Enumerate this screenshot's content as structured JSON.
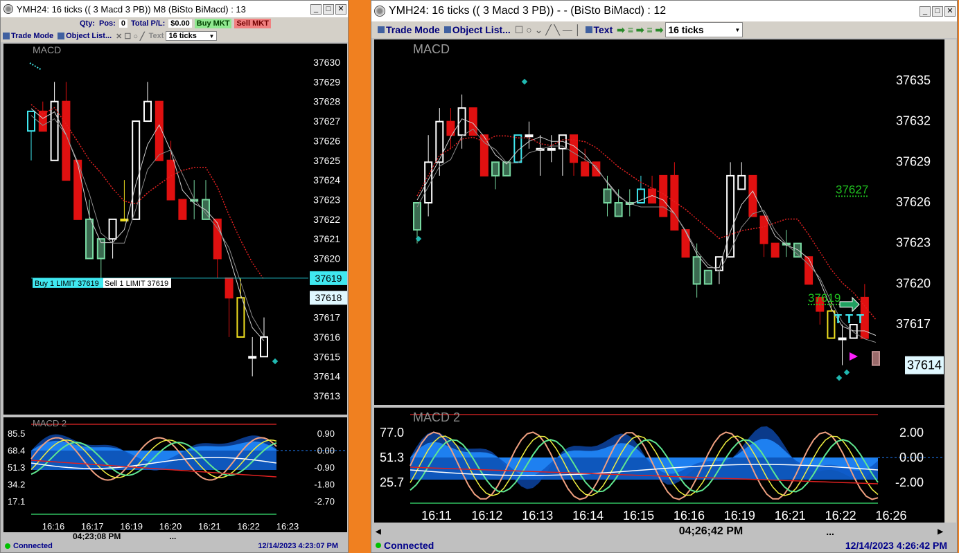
{
  "left": {
    "title": "YMH24: 16 ticks ((  3 Macd  3 PB)) M8 (BiSto BiMacd) : 13",
    "toolbar": {
      "qty_label": "Qty:",
      "pos_label": "Pos:",
      "pos_value": "0",
      "pl_label": "Total P/L:",
      "pl_value": "$0.00",
      "buy_label": "Buy MKT",
      "sell_label": "Sell MKT",
      "trade_mode": "Trade Mode",
      "object_list": "Object List...",
      "text": "Text",
      "ticks": "16 ticks"
    },
    "price_chart": {
      "indicator": "MACD",
      "prices": [
        "37630",
        "37629",
        "37628",
        "37627",
        "37626",
        "37625",
        "37624",
        "37623",
        "37622",
        "37621",
        "37620",
        "37619",
        "37618",
        "37617",
        "37616",
        "37615",
        "37614",
        "37613"
      ],
      "order_buy": "Buy 1 LIMIT 37619",
      "order_sell": "Sell 1 LIMIT 37619",
      "current_price": "37619",
      "price_tag2": "37618",
      "candles": [
        {
          "o": 37626.5,
          "c": 37627.5,
          "h": 37627.5,
          "l": 37625,
          "col": "cyan"
        },
        {
          "o": 37627.5,
          "c": 37626.5,
          "h": 37628,
          "l": 37626.5,
          "col": "red"
        },
        {
          "o": 37625,
          "c": 37628,
          "h": 37629,
          "l": 37625,
          "col": "white"
        },
        {
          "o": 37628,
          "c": 37624,
          "h": 37629,
          "l": 37624,
          "col": "red"
        },
        {
          "o": 37625,
          "c": 37622,
          "h": 37625,
          "l": 37622,
          "col": "red"
        },
        {
          "o": 37622,
          "c": 37620,
          "h": 37623,
          "l": 37620,
          "col": "green"
        },
        {
          "o": 37621,
          "c": 37620,
          "h": 37621,
          "l": 37619,
          "col": "green"
        },
        {
          "o": 37621,
          "c": 37622,
          "h": 37622,
          "l": 37620,
          "col": "white"
        },
        {
          "o": 37622,
          "c": 37622,
          "h": 37624,
          "l": 37622,
          "col": "yellow"
        },
        {
          "o": 37622,
          "c": 37627,
          "h": 37627,
          "l": 37622,
          "col": "white"
        },
        {
          "o": 37627,
          "c": 37628,
          "h": 37629,
          "l": 37627,
          "col": "white"
        },
        {
          "o": 37628,
          "c": 37625,
          "h": 37628,
          "l": 37625,
          "col": "red"
        },
        {
          "o": 37625,
          "c": 37623,
          "h": 37626,
          "l": 37623,
          "col": "red"
        },
        {
          "o": 37623,
          "c": 37622,
          "h": 37623,
          "l": 37622,
          "col": "red"
        },
        {
          "o": 37623,
          "c": 37623,
          "h": 37624,
          "l": 37622,
          "col": "green"
        },
        {
          "o": 37623,
          "c": 37622,
          "h": 37624,
          "l": 37622,
          "col": "green"
        },
        {
          "o": 37622,
          "c": 37620,
          "h": 37622,
          "l": 37619,
          "col": "red"
        },
        {
          "o": 37619,
          "c": 37618,
          "h": 37619,
          "l": 37616,
          "col": "red"
        },
        {
          "o": 37618,
          "c": 37616,
          "h": 37619,
          "l": 37616,
          "col": "yellow"
        },
        {
          "o": 37615,
          "c": 37615,
          "h": 37616,
          "l": 37614,
          "col": "white"
        },
        {
          "o": 37615,
          "c": 37616,
          "h": 37617,
          "l": 37615,
          "col": "white"
        }
      ]
    },
    "macd_panel": {
      "label": "MACD 2",
      "left_scale": [
        "85.5",
        "68.4",
        "51.3",
        "34.2",
        "17.1"
      ],
      "right_scale": [
        "0.90",
        "0.00",
        "-0.90",
        "-1.80",
        "-2.70"
      ],
      "times": [
        "16:16",
        "16:17",
        "16:19",
        "16:20",
        "16:21",
        "16:22",
        "16:23"
      ]
    },
    "scroll_time": "04;23;08  PM",
    "status": "Connected",
    "datetime": "12/14/2023 4:23:07 PM"
  },
  "right": {
    "title": "YMH24: 16 ticks ((  3 Macd  3 PB)) - -  (BiSto BiMacd) : 12",
    "toolbar": {
      "trade_mode": "Trade Mode",
      "object_list": "Object List...",
      "text": "Text",
      "ticks": "16 ticks"
    },
    "price_chart": {
      "indicator": "MACD",
      "prices": [
        "37635",
        "37632",
        "37629",
        "37626",
        "37623",
        "37620",
        "37617"
      ],
      "current_price": "37614",
      "label_upper": "37627",
      "label_lower": "37619",
      "candles": [
        {
          "o": 37624,
          "c": 37626,
          "h": 37626,
          "l": 37623,
          "col": "green"
        },
        {
          "o": 37626,
          "c": 37629,
          "h": 37631,
          "l": 37625,
          "col": "white"
        },
        {
          "o": 37629,
          "c": 37632,
          "h": 37633,
          "l": 37628,
          "col": "white"
        },
        {
          "o": 37632,
          "c": 37631,
          "h": 37633,
          "l": 37630,
          "col": "red"
        },
        {
          "o": 37631,
          "c": 37633,
          "h": 37634,
          "l": 37630,
          "col": "white"
        },
        {
          "o": 37633,
          "c": 37631,
          "h": 37633,
          "l": 37631,
          "col": "red"
        },
        {
          "o": 37631,
          "c": 37628,
          "h": 37631,
          "l": 37628,
          "col": "red"
        },
        {
          "o": 37628,
          "c": 37629,
          "h": 37629,
          "l": 37627,
          "col": "green"
        },
        {
          "o": 37628,
          "c": 37629,
          "h": 37629,
          "l": 37628,
          "col": "green"
        },
        {
          "o": 37629,
          "c": 37631,
          "h": 37631,
          "l": 37629,
          "col": "cyan"
        },
        {
          "o": 37631,
          "c": 37631,
          "h": 37632,
          "l": 37630,
          "col": "white"
        },
        {
          "o": 37630,
          "c": 37630,
          "h": 37631,
          "l": 37628,
          "col": "white"
        },
        {
          "o": 37630,
          "c": 37630,
          "h": 37631,
          "l": 37629,
          "col": "white"
        },
        {
          "o": 37630,
          "c": 37631,
          "h": 37631,
          "l": 37628,
          "col": "white"
        },
        {
          "o": 37631,
          "c": 37629,
          "h": 37631,
          "l": 37628,
          "col": "red"
        },
        {
          "o": 37629,
          "c": 37628,
          "h": 37630,
          "l": 37628,
          "col": "red"
        },
        {
          "o": 37629,
          "c": 37628,
          "h": 37629,
          "l": 37628,
          "col": "red"
        },
        {
          "o": 37627,
          "c": 37626,
          "h": 37628,
          "l": 37625,
          "col": "green"
        },
        {
          "o": 37626,
          "c": 37625,
          "h": 37627,
          "l": 37625,
          "col": "green"
        },
        {
          "o": 37626,
          "c": 37626,
          "h": 37627,
          "l": 37625,
          "col": "green"
        },
        {
          "o": 37626,
          "c": 37627,
          "h": 37628,
          "l": 37626,
          "col": "cyan"
        },
        {
          "o": 37627,
          "c": 37626,
          "h": 37628,
          "l": 37626,
          "col": "red"
        },
        {
          "o": 37628,
          "c": 37625,
          "h": 37628,
          "l": 37625,
          "col": "red"
        },
        {
          "o": 37628,
          "c": 37624,
          "h": 37629,
          "l": 37624,
          "col": "red"
        },
        {
          "o": 37624,
          "c": 37622,
          "h": 37624,
          "l": 37622,
          "col": "red"
        },
        {
          "o": 37622,
          "c": 37620,
          "h": 37623,
          "l": 37619,
          "col": "green"
        },
        {
          "o": 37620,
          "c": 37621,
          "h": 37621,
          "l": 37620,
          "col": "green"
        },
        {
          "o": 37621,
          "c": 37622,
          "h": 37622,
          "l": 37620,
          "col": "white"
        },
        {
          "o": 37622,
          "c": 37628,
          "h": 37629,
          "l": 37622,
          "col": "white"
        },
        {
          "o": 37628,
          "c": 37627,
          "h": 37629,
          "l": 37627,
          "col": "white"
        },
        {
          "o": 37628,
          "c": 37625,
          "h": 37628,
          "l": 37625,
          "col": "red"
        },
        {
          "o": 37625,
          "c": 37623,
          "h": 37625,
          "l": 37622,
          "col": "red"
        },
        {
          "o": 37623,
          "c": 37622,
          "h": 37623,
          "l": 37622,
          "col": "red"
        },
        {
          "o": 37623,
          "c": 37623,
          "h": 37624,
          "l": 37622,
          "col": "green"
        },
        {
          "o": 37623,
          "c": 37622,
          "h": 37623,
          "l": 37622,
          "col": "green"
        },
        {
          "o": 37622,
          "c": 37620,
          "h": 37622,
          "l": 37620,
          "col": "red"
        },
        {
          "o": 37619,
          "c": 37618,
          "h": 37619,
          "l": 37617,
          "col": "red"
        },
        {
          "o": 37618,
          "c": 37616,
          "h": 37619,
          "l": 37616,
          "col": "yellow"
        },
        {
          "o": 37616,
          "c": 37616,
          "h": 37617,
          "l": 37614,
          "col": "white"
        },
        {
          "o": 37616,
          "c": 37617,
          "h": 37617,
          "l": 37616,
          "col": "white"
        },
        {
          "o": 37619,
          "c": 37616,
          "h": 37620,
          "l": 37616,
          "col": "red"
        },
        {
          "o": 37614,
          "c": 37615,
          "h": 37615,
          "l": 37614,
          "col": "brown"
        }
      ]
    },
    "macd_panel": {
      "label": "MACD 2",
      "left_scale": [
        "77.0",
        "51.3",
        "25.7"
      ],
      "right_scale": [
        "2.00",
        "0.00",
        "-2.00"
      ],
      "times": [
        "16:11",
        "16:12",
        "16:13",
        "16:14",
        "16:15",
        "16:16",
        "16:19",
        "16:21",
        "16:22",
        "16:26"
      ]
    },
    "scroll_time": "04;26;42  PM",
    "status": "Connected",
    "datetime": "12/14/2023 4:26:42 PM"
  },
  "colors": {
    "background_frame": "#f08020",
    "candle_red": "#e01010",
    "candle_green": "#78d8a0",
    "candle_cyan": "#40e8f0",
    "candle_yellow": "#f0e020",
    "macd_blue": "#1060d0",
    "ma_red": "#e02020"
  }
}
